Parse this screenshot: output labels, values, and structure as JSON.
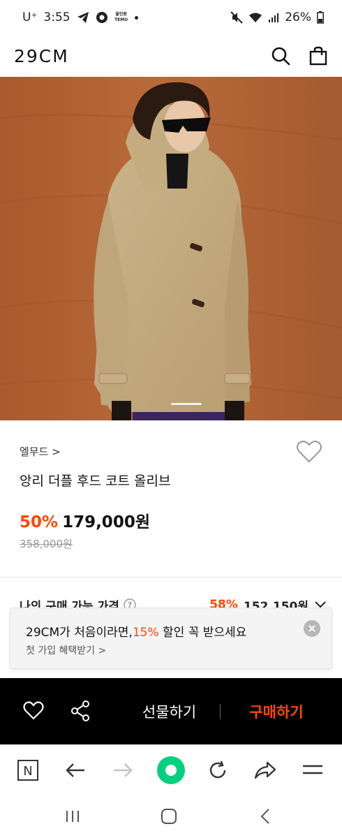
{
  "status_bar": {
    "carrier": "U⁺",
    "time": "3:55",
    "notif_logo": "올인원\nTEMU",
    "battery": "26%"
  },
  "header": {
    "brand": "29CM",
    "icons": [
      "search-icon",
      "shopping-bag-icon"
    ]
  },
  "product": {
    "brand_link": "엘무드 >",
    "name": "앙리 더플 후드 코트 올리브",
    "discount": "50%",
    "price": "179,000원",
    "original_price": "358,000원"
  },
  "my_price": {
    "label": "나의 구매 가능 가격",
    "percent": "58%",
    "price": "152,150원"
  },
  "promo": {
    "text_before": "29CM가 처음이라면,",
    "percent": "15%",
    "text_after": " 할인 꼭 받으세요",
    "sub": "첫 가입 혜택받기 >"
  },
  "action_bar": {
    "gift_label": "선물하기",
    "buy_label": "구매하기"
  },
  "browser_bar": {
    "n_label": "N"
  },
  "colors": {
    "accent": "#ff4800",
    "browser_green": "#00d07f",
    "action_bar_bg": "#000000"
  }
}
